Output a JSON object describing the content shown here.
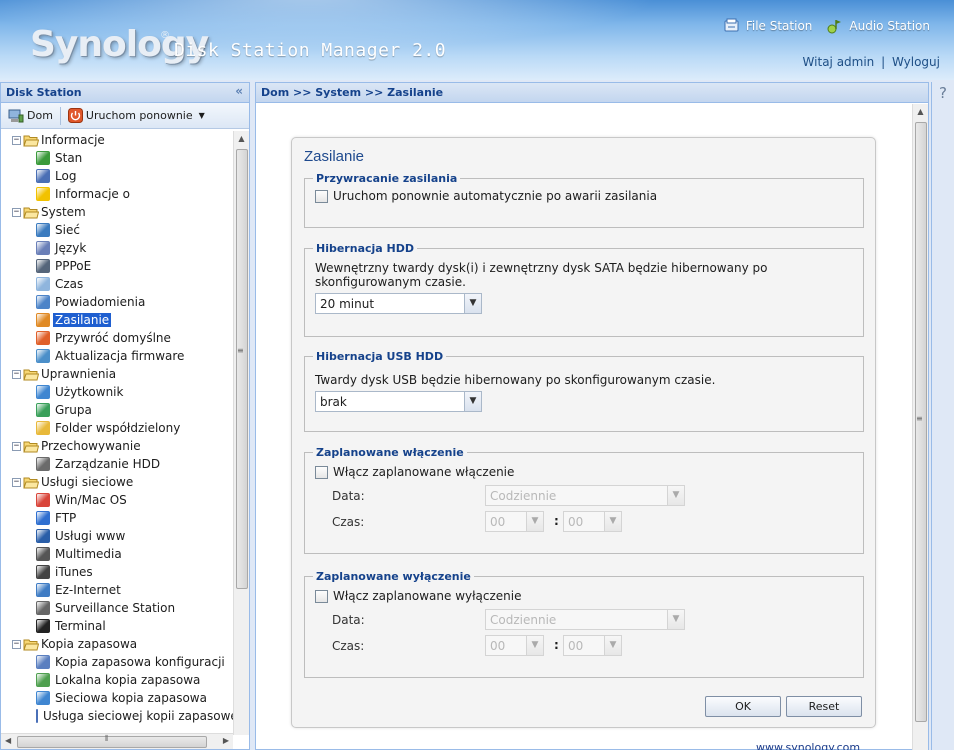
{
  "header": {
    "logo": "Synology",
    "logo_reg": "®",
    "product": "Disk Station Manager 2.0",
    "apps": [
      {
        "label": "File Station",
        "icon": "file-station-icon"
      },
      {
        "label": "Audio Station",
        "icon": "audio-station-icon"
      }
    ],
    "welcome": "Witaj admin",
    "separator": "|",
    "logout": "Wyloguj"
  },
  "sidebar": {
    "title": "Disk Station",
    "collapse_glyph": "«",
    "toolbar": {
      "home": "Dom",
      "restart": "Uruchom ponownie"
    },
    "tree": [
      {
        "type": "group",
        "label": "Informacje",
        "toggle": "−"
      },
      {
        "type": "item",
        "label": "Stan",
        "icon": "status-icon",
        "color": "#3a9a3a"
      },
      {
        "type": "item",
        "label": "Log",
        "icon": "log-icon",
        "color": "#4a6fb5"
      },
      {
        "type": "item",
        "label": "Informacje o",
        "icon": "info-bulb-icon",
        "color": "#f2c200"
      },
      {
        "type": "group",
        "label": "System",
        "toggle": "−"
      },
      {
        "type": "item",
        "label": "Sieć",
        "icon": "network-icon",
        "color": "#3b7bbf"
      },
      {
        "type": "item",
        "label": "Język",
        "icon": "language-icon",
        "color": "#6a7fb8"
      },
      {
        "type": "item",
        "label": "PPPoE",
        "icon": "pppoe-icon",
        "color": "#55657a"
      },
      {
        "type": "item",
        "label": "Czas",
        "icon": "clock-icon",
        "color": "#8fb5dd"
      },
      {
        "type": "item",
        "label": "Powiadomienia",
        "icon": "notification-icon",
        "color": "#4d84c8"
      },
      {
        "type": "item",
        "label": "Zasilanie",
        "icon": "power-icon",
        "color": "#e08a25",
        "selected": true
      },
      {
        "type": "item",
        "label": "Przywróć domyślne",
        "icon": "restore-icon",
        "color": "#e0602a"
      },
      {
        "type": "item",
        "label": "Aktualizacja firmware",
        "icon": "firmware-icon",
        "color": "#4b8fc9"
      },
      {
        "type": "group",
        "label": "Uprawnienia",
        "toggle": "−"
      },
      {
        "type": "item",
        "label": "Użytkownik",
        "icon": "user-icon",
        "color": "#3f86d1"
      },
      {
        "type": "item",
        "label": "Grupa",
        "icon": "group-icon",
        "color": "#3aa05a"
      },
      {
        "type": "item",
        "label": "Folder współdzielony",
        "icon": "shared-folder-icon",
        "color": "#e8b93a"
      },
      {
        "type": "group",
        "label": "Przechowywanie",
        "toggle": "−"
      },
      {
        "type": "item",
        "label": "Zarządzanie HDD",
        "icon": "hdd-icon",
        "color": "#6b6b6b"
      },
      {
        "type": "group",
        "label": "Usługi sieciowe",
        "toggle": "−"
      },
      {
        "type": "item",
        "label": "Win/Mac OS",
        "icon": "winmac-icon",
        "color": "#d9453a"
      },
      {
        "type": "item",
        "label": "FTP",
        "icon": "ftp-icon",
        "color": "#2f6fd0"
      },
      {
        "type": "item",
        "label": "Usługi www",
        "icon": "www-icon",
        "color": "#2a5ea8"
      },
      {
        "type": "item",
        "label": "Multimedia",
        "icon": "multimedia-icon",
        "color": "#555555"
      },
      {
        "type": "item",
        "label": "iTunes",
        "icon": "itunes-icon",
        "color": "#444444"
      },
      {
        "type": "item",
        "label": "Ez-Internet",
        "icon": "ez-internet-icon",
        "color": "#3f7cc4"
      },
      {
        "type": "item",
        "label": "Surveillance Station",
        "icon": "camera-icon",
        "color": "#666666"
      },
      {
        "type": "item",
        "label": "Terminal",
        "icon": "terminal-icon",
        "color": "#222222"
      },
      {
        "type": "group",
        "label": "Kopia zapasowa",
        "toggle": "−"
      },
      {
        "type": "item",
        "label": "Kopia zapasowa konfiguracji",
        "icon": "config-backup-icon",
        "color": "#5a7fc0"
      },
      {
        "type": "item",
        "label": "Lokalna kopia zapasowa",
        "icon": "local-backup-icon",
        "color": "#4fa04f"
      },
      {
        "type": "item",
        "label": "Sieciowa kopia zapasowa",
        "icon": "network-backup-icon",
        "color": "#3f86d1"
      },
      {
        "type": "item",
        "label": "Usługa sieciowej kopii zapasowej",
        "icon": "backup-service-icon",
        "color": "#4a70b8"
      }
    ]
  },
  "main": {
    "breadcrumb": "Dom >> System >> Zasilanie",
    "help": "?",
    "title": "Zasilanie",
    "power_recovery": {
      "legend": "Przywracanie zasilania",
      "checkbox": "Uruchom ponownie automatycznie po awarii zasilania"
    },
    "hdd_hibernation": {
      "legend": "Hibernacja HDD",
      "desc": "Wewnętrzny twardy dysk(i) i zewnętrzny dysk SATA będzie hibernowany po skonfigurowanym czasie.",
      "value": "20 minut"
    },
    "usb_hibernation": {
      "legend": "Hibernacja USB HDD",
      "desc": "Twardy dysk USB będzie hibernowany po skonfigurowanym czasie.",
      "value": "brak"
    },
    "scheduled_on": {
      "legend": "Zaplanowane włączenie",
      "checkbox": "Włącz zaplanowane włączenie",
      "date_label": "Data:",
      "date_value": "Codziennie",
      "time_label": "Czas:",
      "hour": "00",
      "minute": "00",
      "colon": ":"
    },
    "scheduled_off": {
      "legend": "Zaplanowane wyłączenie",
      "checkbox": "Włącz zaplanowane wyłączenie",
      "date_label": "Data:",
      "date_value": "Codziennie",
      "time_label": "Czas:",
      "hour": "00",
      "minute": "00",
      "colon": ":"
    },
    "ok": "OK",
    "reset": "Reset",
    "footer_link": "www.synology.com"
  }
}
